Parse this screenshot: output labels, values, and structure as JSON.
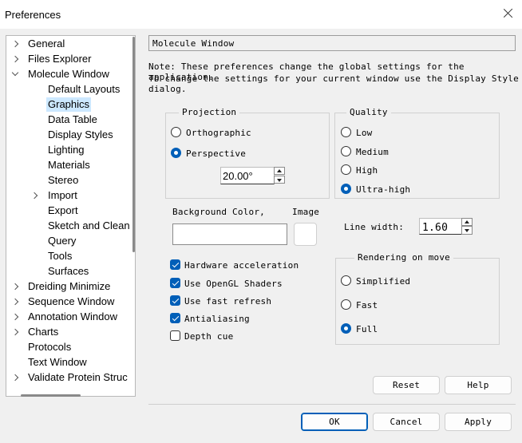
{
  "window": {
    "title": "Preferences"
  },
  "tree": {
    "items": [
      {
        "label": "General",
        "level": 0,
        "expand": "right"
      },
      {
        "label": "Files Explorer",
        "level": 0,
        "expand": "right"
      },
      {
        "label": "Molecule Window",
        "level": 0,
        "expand": "down"
      },
      {
        "label": "Default Layouts",
        "level": 1,
        "expand": ""
      },
      {
        "label": "Graphics",
        "level": 1,
        "expand": "",
        "selected": true
      },
      {
        "label": "Data Table",
        "level": 1,
        "expand": ""
      },
      {
        "label": "Display Styles",
        "level": 1,
        "expand": ""
      },
      {
        "label": "Lighting",
        "level": 1,
        "expand": ""
      },
      {
        "label": "Materials",
        "level": 1,
        "expand": ""
      },
      {
        "label": "Stereo",
        "level": 1,
        "expand": ""
      },
      {
        "label": "Import",
        "level": 1,
        "expand": "right"
      },
      {
        "label": "Export",
        "level": 1,
        "expand": ""
      },
      {
        "label": "Sketch and Clean",
        "level": 1,
        "expand": ""
      },
      {
        "label": "Query",
        "level": 1,
        "expand": ""
      },
      {
        "label": "Tools",
        "level": 1,
        "expand": ""
      },
      {
        "label": "Surfaces",
        "level": 1,
        "expand": ""
      },
      {
        "label": "Dreiding Minimize",
        "level": 0,
        "expand": "right"
      },
      {
        "label": "Sequence Window",
        "level": 0,
        "expand": "right"
      },
      {
        "label": "Annotation Window",
        "level": 0,
        "expand": "right"
      },
      {
        "label": "Charts",
        "level": 0,
        "expand": "right"
      },
      {
        "label": "Protocols",
        "level": 0,
        "expand": ""
      },
      {
        "label": "Text Window",
        "level": 0,
        "expand": ""
      },
      {
        "label": "Validate Protein Struc",
        "level": 0,
        "expand": "right"
      }
    ]
  },
  "panel": {
    "header": "Molecule Window",
    "note_line1": "Note: These preferences change the global settings for the application.",
    "note_line2": "To change the settings for your current window use the Display Style dialog."
  },
  "projection": {
    "legend": "Projection",
    "orthographic": "Orthographic",
    "perspective": "Perspective",
    "selected": "perspective",
    "angle": "20.00°"
  },
  "quality": {
    "legend": "Quality",
    "options": [
      "Low",
      "Medium",
      "High",
      "Ultra-high"
    ],
    "selected": "Ultra-high"
  },
  "background": {
    "label": "Background Color,",
    "image_label": "Image"
  },
  "line_width": {
    "label": "Line width:",
    "value": "1.60"
  },
  "checkboxes": [
    {
      "label": "Hardware acceleration",
      "checked": true
    },
    {
      "label": "Use OpenGL Shaders",
      "checked": true
    },
    {
      "label": "Use fast refresh",
      "checked": true
    },
    {
      "label": "Antialiasing",
      "checked": true
    },
    {
      "label": "Depth cue",
      "checked": false
    }
  ],
  "rendering": {
    "legend": "Rendering on move",
    "options": [
      "Simplified",
      "Fast",
      "Full"
    ],
    "selected": "Full"
  },
  "buttons": {
    "reset": "Reset",
    "help": "Help",
    "ok": "OK",
    "cancel": "Cancel",
    "apply": "Apply"
  },
  "colors": {
    "accent": "#005fb8",
    "selection": "#cce8ff"
  }
}
